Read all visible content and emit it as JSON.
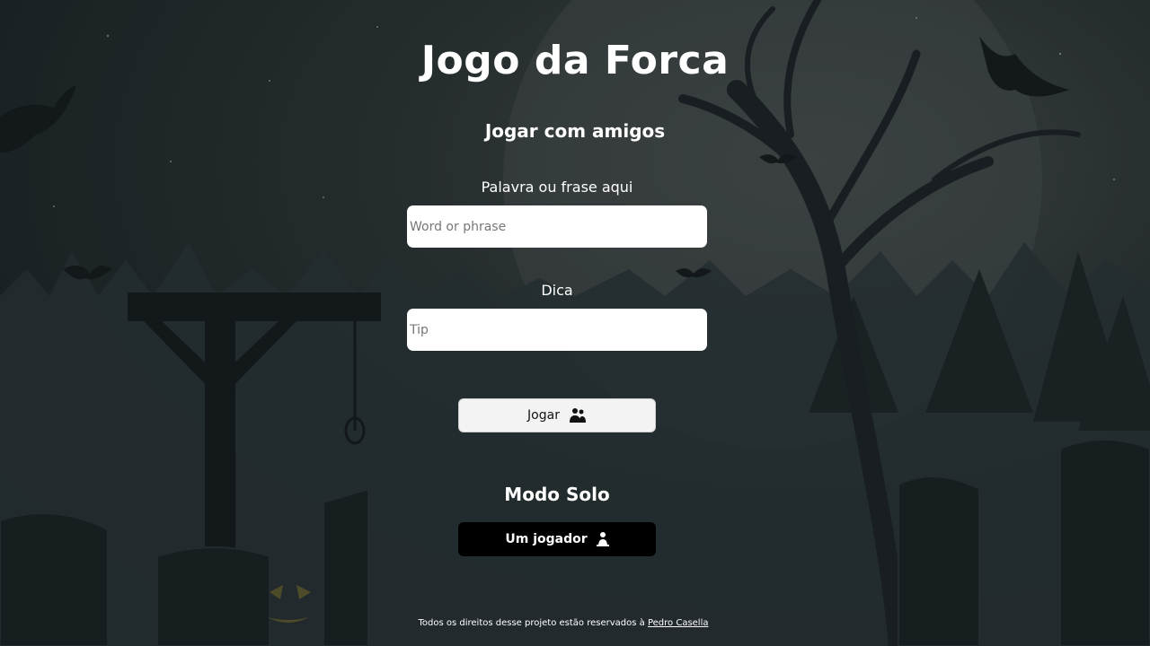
{
  "title": "Jogo da Forca",
  "friends": {
    "heading": "Jogar com amigos",
    "word_label": "Palavra ou frase aqui",
    "word_placeholder": "Word or phrase",
    "tip_label": "Dica",
    "tip_placeholder": "Tip",
    "play_button": "Jogar",
    "play_icon": "users-icon"
  },
  "solo": {
    "heading": "Modo Solo",
    "button": "Um jogador",
    "button_icon": "user-icon"
  },
  "footer": {
    "text": "Todos os direitos desse projeto estão reservados à ",
    "link": "Pedro Casella"
  },
  "colors": {
    "background": "#1e2628",
    "button_play": "#f3f3f3",
    "button_solo": "#000000",
    "text": "#ffffff"
  }
}
